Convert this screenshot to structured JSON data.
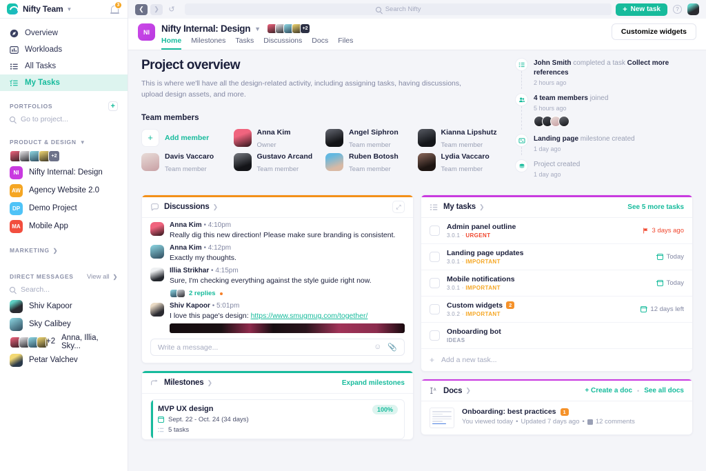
{
  "sidebar": {
    "brand": "Nifty Team",
    "notification_count": "3",
    "nav": [
      {
        "label": "Overview",
        "icon": "compass-icon",
        "active": false
      },
      {
        "label": "Workloads",
        "icon": "bar-chart-icon",
        "active": false
      },
      {
        "label": "All Tasks",
        "icon": "list-icon",
        "active": false
      },
      {
        "label": "My Tasks",
        "icon": "checklist-icon",
        "active": true
      }
    ],
    "portfolios_label": "PORTFOLIOS",
    "portfolio_search_placeholder": "Go to project...",
    "product_design_label": "PRODUCT & DESIGN",
    "member_overflow": "+2",
    "projects": [
      {
        "initials": "NI",
        "label": "Nifty Internal: Design",
        "color": "#c93ae0"
      },
      {
        "initials": "AW",
        "label": "Agency Website 2.0",
        "color": "#f5a623"
      },
      {
        "initials": "DP",
        "label": "Demo Project",
        "color": "#4fc3f7"
      },
      {
        "initials": "MA",
        "label": "Mobile App",
        "color": "#f24e3e"
      }
    ],
    "marketing_label": "MARKETING",
    "dm_label": "DIRECT MESSAGES",
    "dm_viewall": "View all",
    "dm_search_placeholder": "Search...",
    "dms": [
      {
        "label": "Shiv Kapoor",
        "group": false
      },
      {
        "label": "Sky Calibey",
        "group": false
      },
      {
        "label": "Anna, Illia, Sky...",
        "group": true,
        "overflow": "+2"
      },
      {
        "label": "Petar Valchev",
        "group": false
      }
    ]
  },
  "topbar": {
    "back_icon": "chevron-left-icon",
    "forward_icon": "chevron-right-icon",
    "history_icon": "history-icon",
    "search_placeholder": "Search Nifty",
    "new_task_label": "New task",
    "help_icon": "question-mark-icon"
  },
  "project_header": {
    "initials": "NI",
    "title": "Nifty Internal: Design",
    "member_overflow": "+2",
    "tabs": [
      {
        "label": "Home",
        "active": true
      },
      {
        "label": "Milestones",
        "active": false
      },
      {
        "label": "Tasks",
        "active": false
      },
      {
        "label": "Discussions",
        "active": false
      },
      {
        "label": "Docs",
        "active": false
      },
      {
        "label": "Files",
        "active": false
      }
    ],
    "customize_label": "Customize widgets"
  },
  "overview": {
    "title": "Project overview",
    "description": "This is where we'll have all the design-related activity, including assigning tasks, having discussions, upload design assets, and more.",
    "team_members_label": "Team members",
    "add_member_label": "Add member",
    "members": [
      {
        "name": "Anna Kim",
        "role": "Owner",
        "color": "#e8647a"
      },
      {
        "name": "Angel Siphron",
        "role": "Team member",
        "color": "#2f3238"
      },
      {
        "name": "Kianna Lipshutz",
        "role": "Team member",
        "color": "#22252b"
      },
      {
        "name": "Davis Vaccaro",
        "role": "Team member",
        "color": "#d9bfc2"
      },
      {
        "name": "Gustavo Arcand",
        "role": "Team member",
        "color": "#2b2e34"
      },
      {
        "name": "Ruben Botosh",
        "role": "Team member",
        "color": "#4aa6d8"
      },
      {
        "name": "Lydia Vaccaro",
        "role": "Team member",
        "color": "#3c2f2c"
      }
    ]
  },
  "activity": [
    {
      "icon": "checklist-icon",
      "actor": "John Smith",
      "action": "completed a task",
      "target": "Collect more references",
      "time": "2 hours ago",
      "avatars": 0
    },
    {
      "icon": "people-icon",
      "actor": "4 team members",
      "action": "joined",
      "target": "",
      "time": "5 hours ago",
      "avatars": 4
    },
    {
      "icon": "milestone-icon",
      "actor": "Landing page",
      "action": "milestone created",
      "target": "",
      "time": "1 day ago",
      "avatars": 0
    },
    {
      "icon": "project-icon",
      "actor": "",
      "action": "Project created",
      "target": "",
      "time": "1 day ago",
      "avatars": 0
    }
  ],
  "discussions": {
    "title": "Discussions",
    "accent": "#f39019",
    "expand_icon": "expand-icon",
    "messages": [
      {
        "author": "Anna Kim",
        "time": "4:10pm",
        "text": "Really dig this new direction! Please make sure branding is consistent.",
        "link": "",
        "replies": "",
        "image": false,
        "color": "#e8647a"
      },
      {
        "author": "Anna Kim",
        "time": "4:12pm",
        "text": "Exactly my thoughts.",
        "link": "",
        "replies": "",
        "image": false,
        "color": "#7fd4d8"
      },
      {
        "author": "Illia Strikhar",
        "time": "4:15pm",
        "text": "Sure, I'm checking everything against the style guide right now.",
        "link": "",
        "replies": "2 replies",
        "image": false,
        "color": "#f0f0f2"
      },
      {
        "author": "Shiv Kapoor",
        "time": "5:01pm",
        "text": "I love this page's design: ",
        "link": "https://www.smugmug.com/together/",
        "replies": "",
        "image": true,
        "color": "#ecdcc9"
      }
    ],
    "composer_placeholder": "Write a message...",
    "emoji_icon": "smiley-icon",
    "attach_icon": "paperclip-icon"
  },
  "my_tasks": {
    "title": "My tasks",
    "accent": "#c93ae0",
    "see_more": "See 5 more tasks",
    "tasks": [
      {
        "name": "Admin panel outline",
        "version": "3.0.1",
        "label": "URGENT",
        "label_kind": "urgent",
        "due": "3 days ago",
        "due_kind": "red",
        "due_icon": "flag-icon",
        "badge": ""
      },
      {
        "name": "Landing page updates",
        "version": "3.0.1",
        "label": "IMPORTANT",
        "label_kind": "important",
        "due": "Today",
        "due_kind": "normal",
        "due_icon": "calendar-icon",
        "badge": ""
      },
      {
        "name": "Mobile notifications",
        "version": "3.0.1",
        "label": "IMPORTANT",
        "label_kind": "important",
        "due": "Today",
        "due_kind": "normal",
        "due_icon": "calendar-icon",
        "badge": ""
      },
      {
        "name": "Custom widgets",
        "version": "3.0.2",
        "label": "IMPORTANT",
        "label_kind": "important",
        "due": "12 days left",
        "due_kind": "normal",
        "due_icon": "calendar-icon",
        "badge": "2"
      },
      {
        "name": "Onboarding bot",
        "version": "",
        "label": "IDEAS",
        "label_kind": "ideas",
        "due": "",
        "due_kind": "normal",
        "due_icon": "",
        "badge": ""
      }
    ],
    "add_task_placeholder": "Add a new task..."
  },
  "milestones": {
    "title": "Milestones",
    "accent": "#17bb9c",
    "expand_label": "Expand milestones",
    "items": [
      {
        "name": "MVP UX design",
        "dates": "Sept. 22 - Oct. 24 (34 days)",
        "tasks": "5 tasks",
        "percent": "100%"
      }
    ]
  },
  "docs": {
    "title": "Docs",
    "accent": "#c93ae0",
    "create_label": "+ Create a doc",
    "see_all_label": "See all docs",
    "items": [
      {
        "name": "Onboarding: best practices",
        "badge": "1",
        "viewed": "You viewed today",
        "updated": "Updated 7 days ago",
        "comments": "12 comments"
      }
    ]
  }
}
